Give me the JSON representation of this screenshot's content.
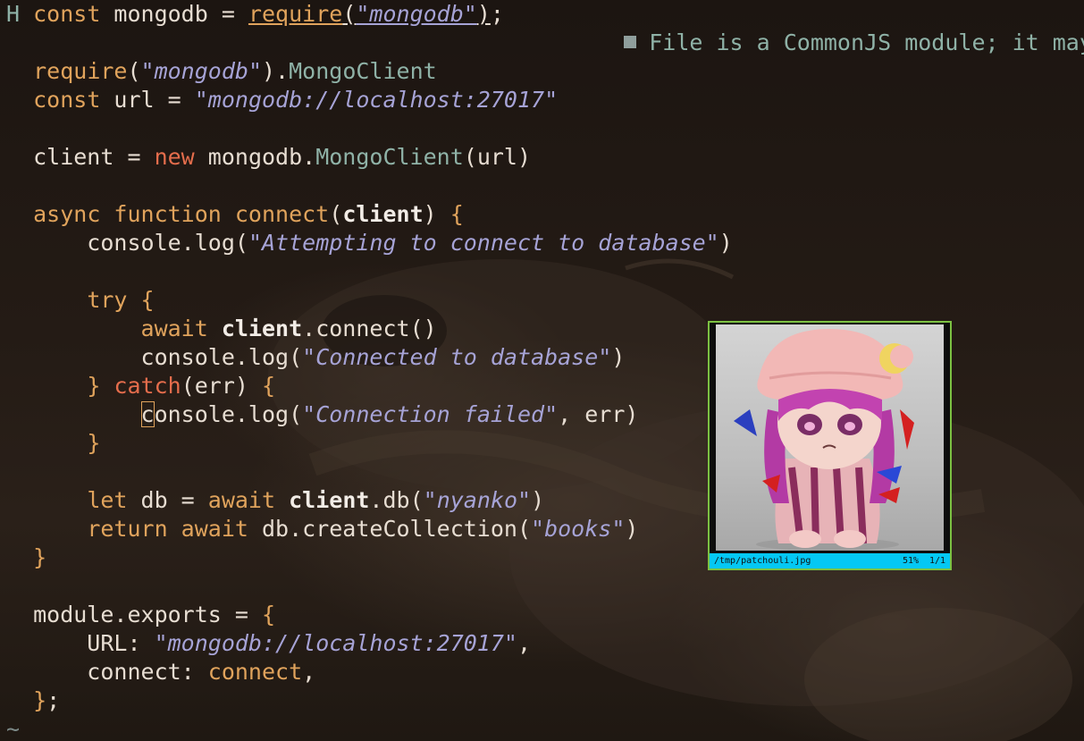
{
  "editor": {
    "lines": [
      {
        "segments": [
          {
            "cls": "sign",
            "text": "H "
          },
          {
            "cls": "kw",
            "text": "const"
          },
          {
            "cls": "",
            "text": " mongodb = "
          },
          {
            "cls": "kwu",
            "text": "require"
          },
          {
            "cls": "u",
            "text": "("
          },
          {
            "cls": "stru",
            "text": "\"mongodb\""
          },
          {
            "cls": "u",
            "text": ")"
          },
          {
            "cls": "",
            "text": ";"
          }
        ]
      },
      {
        "segments": []
      },
      {
        "segments": [
          {
            "cls": "",
            "text": "  "
          },
          {
            "cls": "kw",
            "text": "require"
          },
          {
            "cls": "",
            "text": "("
          },
          {
            "cls": "str",
            "text": "\"mongodb\""
          },
          {
            "cls": "",
            "text": ")."
          },
          {
            "cls": "type",
            "text": "MongoClient"
          }
        ]
      },
      {
        "segments": [
          {
            "cls": "",
            "text": "  "
          },
          {
            "cls": "kw",
            "text": "const"
          },
          {
            "cls": "",
            "text": " url = "
          },
          {
            "cls": "str",
            "text": "\"mongodb://localhost:27017\""
          }
        ]
      },
      {
        "segments": []
      },
      {
        "segments": [
          {
            "cls": "",
            "text": "  client = "
          },
          {
            "cls": "red",
            "text": "new"
          },
          {
            "cls": "",
            "text": " mongodb."
          },
          {
            "cls": "type",
            "text": "MongoClient"
          },
          {
            "cls": "",
            "text": "(url)"
          }
        ]
      },
      {
        "segments": []
      },
      {
        "segments": [
          {
            "cls": "",
            "text": "  "
          },
          {
            "cls": "kw",
            "text": "async function connect"
          },
          {
            "cls": "",
            "text": "("
          },
          {
            "cls": "bold",
            "text": "client"
          },
          {
            "cls": "",
            "text": ") "
          },
          {
            "cls": "kw",
            "text": "{"
          }
        ]
      },
      {
        "segments": [
          {
            "cls": "",
            "text": "      console.log("
          },
          {
            "cls": "str",
            "text": "\"Attempting to connect to database\""
          },
          {
            "cls": "",
            "text": ")"
          }
        ]
      },
      {
        "segments": []
      },
      {
        "segments": [
          {
            "cls": "",
            "text": "      "
          },
          {
            "cls": "kw",
            "text": "try {"
          }
        ]
      },
      {
        "segments": [
          {
            "cls": "",
            "text": "          "
          },
          {
            "cls": "kw",
            "text": "await"
          },
          {
            "cls": "",
            "text": " "
          },
          {
            "cls": "bold",
            "text": "client"
          },
          {
            "cls": "",
            "text": ".connect()"
          }
        ]
      },
      {
        "segments": [
          {
            "cls": "",
            "text": "          console.log("
          },
          {
            "cls": "str",
            "text": "\"Connected to database\""
          },
          {
            "cls": "",
            "text": ")"
          }
        ]
      },
      {
        "segments": [
          {
            "cls": "",
            "text": "      "
          },
          {
            "cls": "kw",
            "text": "}"
          },
          {
            "cls": "",
            "text": " "
          },
          {
            "cls": "red",
            "text": "catch"
          },
          {
            "cls": "",
            "text": "(err) "
          },
          {
            "cls": "kw",
            "text": "{"
          }
        ]
      },
      {
        "segments": [
          {
            "cls": "",
            "text": "          "
          },
          {
            "cls": "cursor",
            "text": "c"
          },
          {
            "cls": "",
            "text": "onsole.log("
          },
          {
            "cls": "str",
            "text": "\"Connection failed\""
          },
          {
            "cls": "",
            "text": ", err)"
          }
        ]
      },
      {
        "segments": [
          {
            "cls": "",
            "text": "      "
          },
          {
            "cls": "kw",
            "text": "}"
          }
        ]
      },
      {
        "segments": []
      },
      {
        "segments": [
          {
            "cls": "",
            "text": "      "
          },
          {
            "cls": "kw",
            "text": "let"
          },
          {
            "cls": "",
            "text": " db = "
          },
          {
            "cls": "kw",
            "text": "await"
          },
          {
            "cls": "",
            "text": " "
          },
          {
            "cls": "bold",
            "text": "client"
          },
          {
            "cls": "",
            "text": ".db("
          },
          {
            "cls": "str",
            "text": "\"nyanko\""
          },
          {
            "cls": "",
            "text": ")"
          }
        ]
      },
      {
        "segments": [
          {
            "cls": "",
            "text": "      "
          },
          {
            "cls": "kw",
            "text": "return await"
          },
          {
            "cls": "",
            "text": " db.createCollection("
          },
          {
            "cls": "str",
            "text": "\"books\""
          },
          {
            "cls": "",
            "text": ")"
          }
        ]
      },
      {
        "segments": [
          {
            "cls": "",
            "text": "  "
          },
          {
            "cls": "kw",
            "text": "}"
          }
        ]
      },
      {
        "segments": []
      },
      {
        "segments": [
          {
            "cls": "",
            "text": "  module.exports = "
          },
          {
            "cls": "kw",
            "text": "{"
          }
        ]
      },
      {
        "segments": [
          {
            "cls": "",
            "text": "      URL: "
          },
          {
            "cls": "str",
            "text": "\"mongodb://localhost:27017\""
          },
          {
            "cls": "",
            "text": ","
          }
        ]
      },
      {
        "segments": [
          {
            "cls": "",
            "text": "      connect: "
          },
          {
            "cls": "kw",
            "text": "connect"
          },
          {
            "cls": "",
            "text": ","
          }
        ]
      },
      {
        "segments": [
          {
            "cls": "",
            "text": "  "
          },
          {
            "cls": "kw",
            "text": "}"
          },
          {
            "cls": "",
            "text": ";"
          }
        ]
      }
    ],
    "diagnostic": "File is a CommonJS module; it may be",
    "tilde": "~"
  },
  "image_preview": {
    "path": "/tmp/patchouli.jpg",
    "zoom": "51%",
    "count": "1/1"
  },
  "colors": {
    "keyword": "#e0a35c",
    "new_catch": "#e56d4c",
    "type": "#8fb2a7",
    "string": "#a6a3d6",
    "preview_border": "#7cc142",
    "preview_status": "#04c8f4"
  }
}
